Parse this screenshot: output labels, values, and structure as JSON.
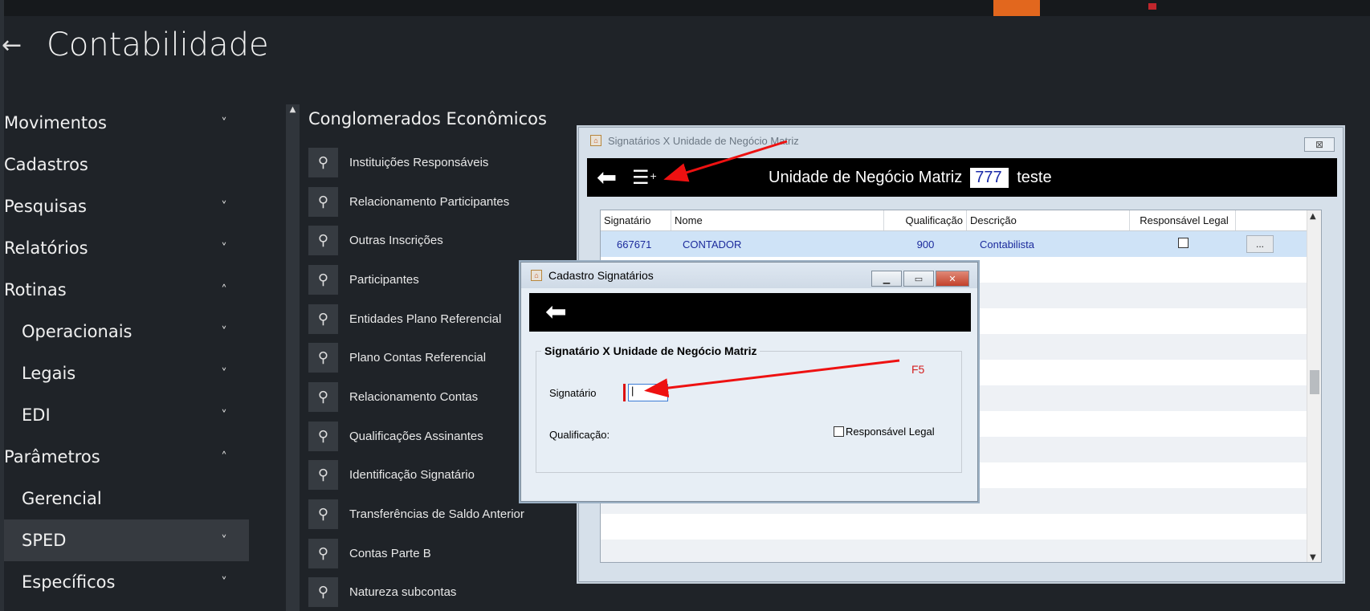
{
  "app": {
    "title": "Contabilidade"
  },
  "nav": {
    "items": [
      {
        "label": "Movimentos",
        "chevron": "˅"
      },
      {
        "label": "Cadastros",
        "chevron": ""
      },
      {
        "label": "Pesquisas",
        "chevron": "˅"
      },
      {
        "label": "Relatórios",
        "chevron": "˅"
      },
      {
        "label": "Rotinas",
        "chevron": "˄"
      },
      {
        "label": "Operacionais",
        "chevron": "˅"
      },
      {
        "label": "Legais",
        "chevron": "˅"
      },
      {
        "label": "EDI",
        "chevron": "˅"
      },
      {
        "label": "Parâmetros",
        "chevron": "˄"
      },
      {
        "label": "Gerencial",
        "chevron": ""
      },
      {
        "label": "SPED",
        "chevron": "˅"
      },
      {
        "label": "Específicos",
        "chevron": "˅"
      }
    ]
  },
  "submenu": {
    "title": "Conglomerados Econômicos",
    "items": [
      "Instituições Responsáveis",
      "Relacionamento Participantes",
      "Outras Inscrições",
      "Participantes",
      "Entidades Plano Referencial",
      "Plano Contas Referencial",
      "Relacionamento Contas",
      "Qualificações Assinantes",
      "Identificação Signatário",
      "Transferências de Saldo Anterior",
      "Contas Parte B",
      "Natureza subcontas"
    ]
  },
  "win1": {
    "title": "Signatários X Unidade de Negócio Matriz",
    "toolbar": {
      "label": "Unidade de Negócio Matriz",
      "value": "777",
      "desc": "teste"
    },
    "columns": [
      "Signatário",
      "Nome",
      "Qualificação",
      "Descrição",
      "Responsável Legal"
    ],
    "rows": [
      {
        "signatario": "667671",
        "nome": "CONTADOR",
        "qualificacao": "900",
        "descricao": "Contabilista",
        "responsavel": false,
        "btn": "..."
      }
    ]
  },
  "win2": {
    "title": "Cadastro Signatários",
    "group_title": "Signatário X Unidade de Negócio Matriz",
    "signatario_label": "Signatário",
    "signatario_value": "|",
    "qualificacao_label": "Qualificação:",
    "responsavel_label": "Responsável Legal"
  },
  "annotation": {
    "key": "F5",
    "color": "#d41e1e"
  },
  "colors": {
    "accent": "#e2671e",
    "background": "#1f2328",
    "selection": "#cfe3f7"
  }
}
